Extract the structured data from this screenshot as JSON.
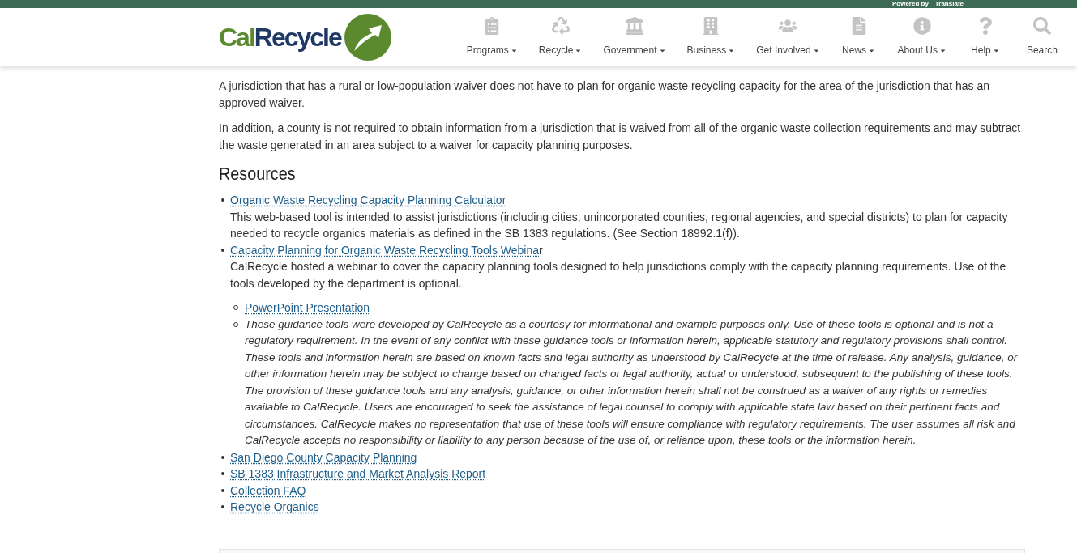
{
  "top_bar": {
    "powered_by": "Powered by",
    "translate": "Translate"
  },
  "logo": {
    "part_1": "Cal",
    "part_2": "Recycle"
  },
  "nav": [
    {
      "label": "Programs",
      "dropdown": true
    },
    {
      "label": "Recycle",
      "dropdown": true
    },
    {
      "label": "Government",
      "dropdown": true
    },
    {
      "label": "Business",
      "dropdown": true
    },
    {
      "label": "Get Involved",
      "dropdown": true
    },
    {
      "label": "News",
      "dropdown": true
    },
    {
      "label": "About Us",
      "dropdown": true
    },
    {
      "label": "Help",
      "dropdown": true
    },
    {
      "label": "Search",
      "dropdown": false
    }
  ],
  "intro": [
    "A jurisdiction that has a rural or low-population waiver does not have to plan for organic waste recycling capacity for the area of the jurisdiction that has an approved waiver.",
    "In addition, a county is not required to obtain information from a jurisdiction that is waived from all of the organic waste collection requirements and may subtract the waste generated in an area subject to a waiver for capacity planning purposes."
  ],
  "resources": {
    "heading": "Resources",
    "items": [
      {
        "link": "Organic Waste Recycling Capacity Planning Calculator",
        "description": "This web-based tool is intended to assist jurisdictions (including cities, unincorporated counties, regional agencies, and special districts) to plan for capacity needed to recycle organics materials as defined in the SB 1383 regulations. (See Section 18992.1(f))."
      },
      {
        "link": "Capacity Planning for Organic Waste Recycling Tools Webina",
        "link_tail": "r",
        "description": "CalRecycle hosted a webinar to cover the capacity planning tools designed to help jurisdictions comply with the capacity planning requirements. Use of the tools developed by the department is optional.",
        "children": [
          {
            "kind": "link",
            "text": "PowerPoint Presentation"
          },
          {
            "kind": "note",
            "text": "These guidance tools were developed by CalRecycle as a courtesy for informational and example purposes only. Use of these tools is optional and is not a regulatory requirement. In the event of any conflict with these guidance tools or information herein, applicable statutory and regulatory provisions shall control. These tools and information herein are based on known facts and legal authority as understood by CalRecycle at the time of release. Any analysis, guidance, or other information herein may be subject to change based on changed facts or legal authority, actual or understood, subsequent to the publishing of these tools. The provision of these guidance tools and any analysis, guidance, or other information herein shall not be construed as a waiver of any rights or remedies available to CalRecycle. Users are encouraged to seek the assistance of legal counsel to comply with applicable state law based on their pertinent facts and circumstances. CalRecycle makes no representation that use of these tools will ensure compliance with regulatory requirements. The user assumes all risk and CalRecycle accepts no responsibility or liability to any person because of the use of, or reliance upon, these tools or the information herein."
          }
        ]
      },
      {
        "link": "San Diego County Capacity Planning"
      },
      {
        "link": "SB 1383 Infrastructure and Market Analysis Report"
      },
      {
        "link": "Collection FAQ"
      },
      {
        "link": "Recycle Organics"
      }
    ]
  }
}
